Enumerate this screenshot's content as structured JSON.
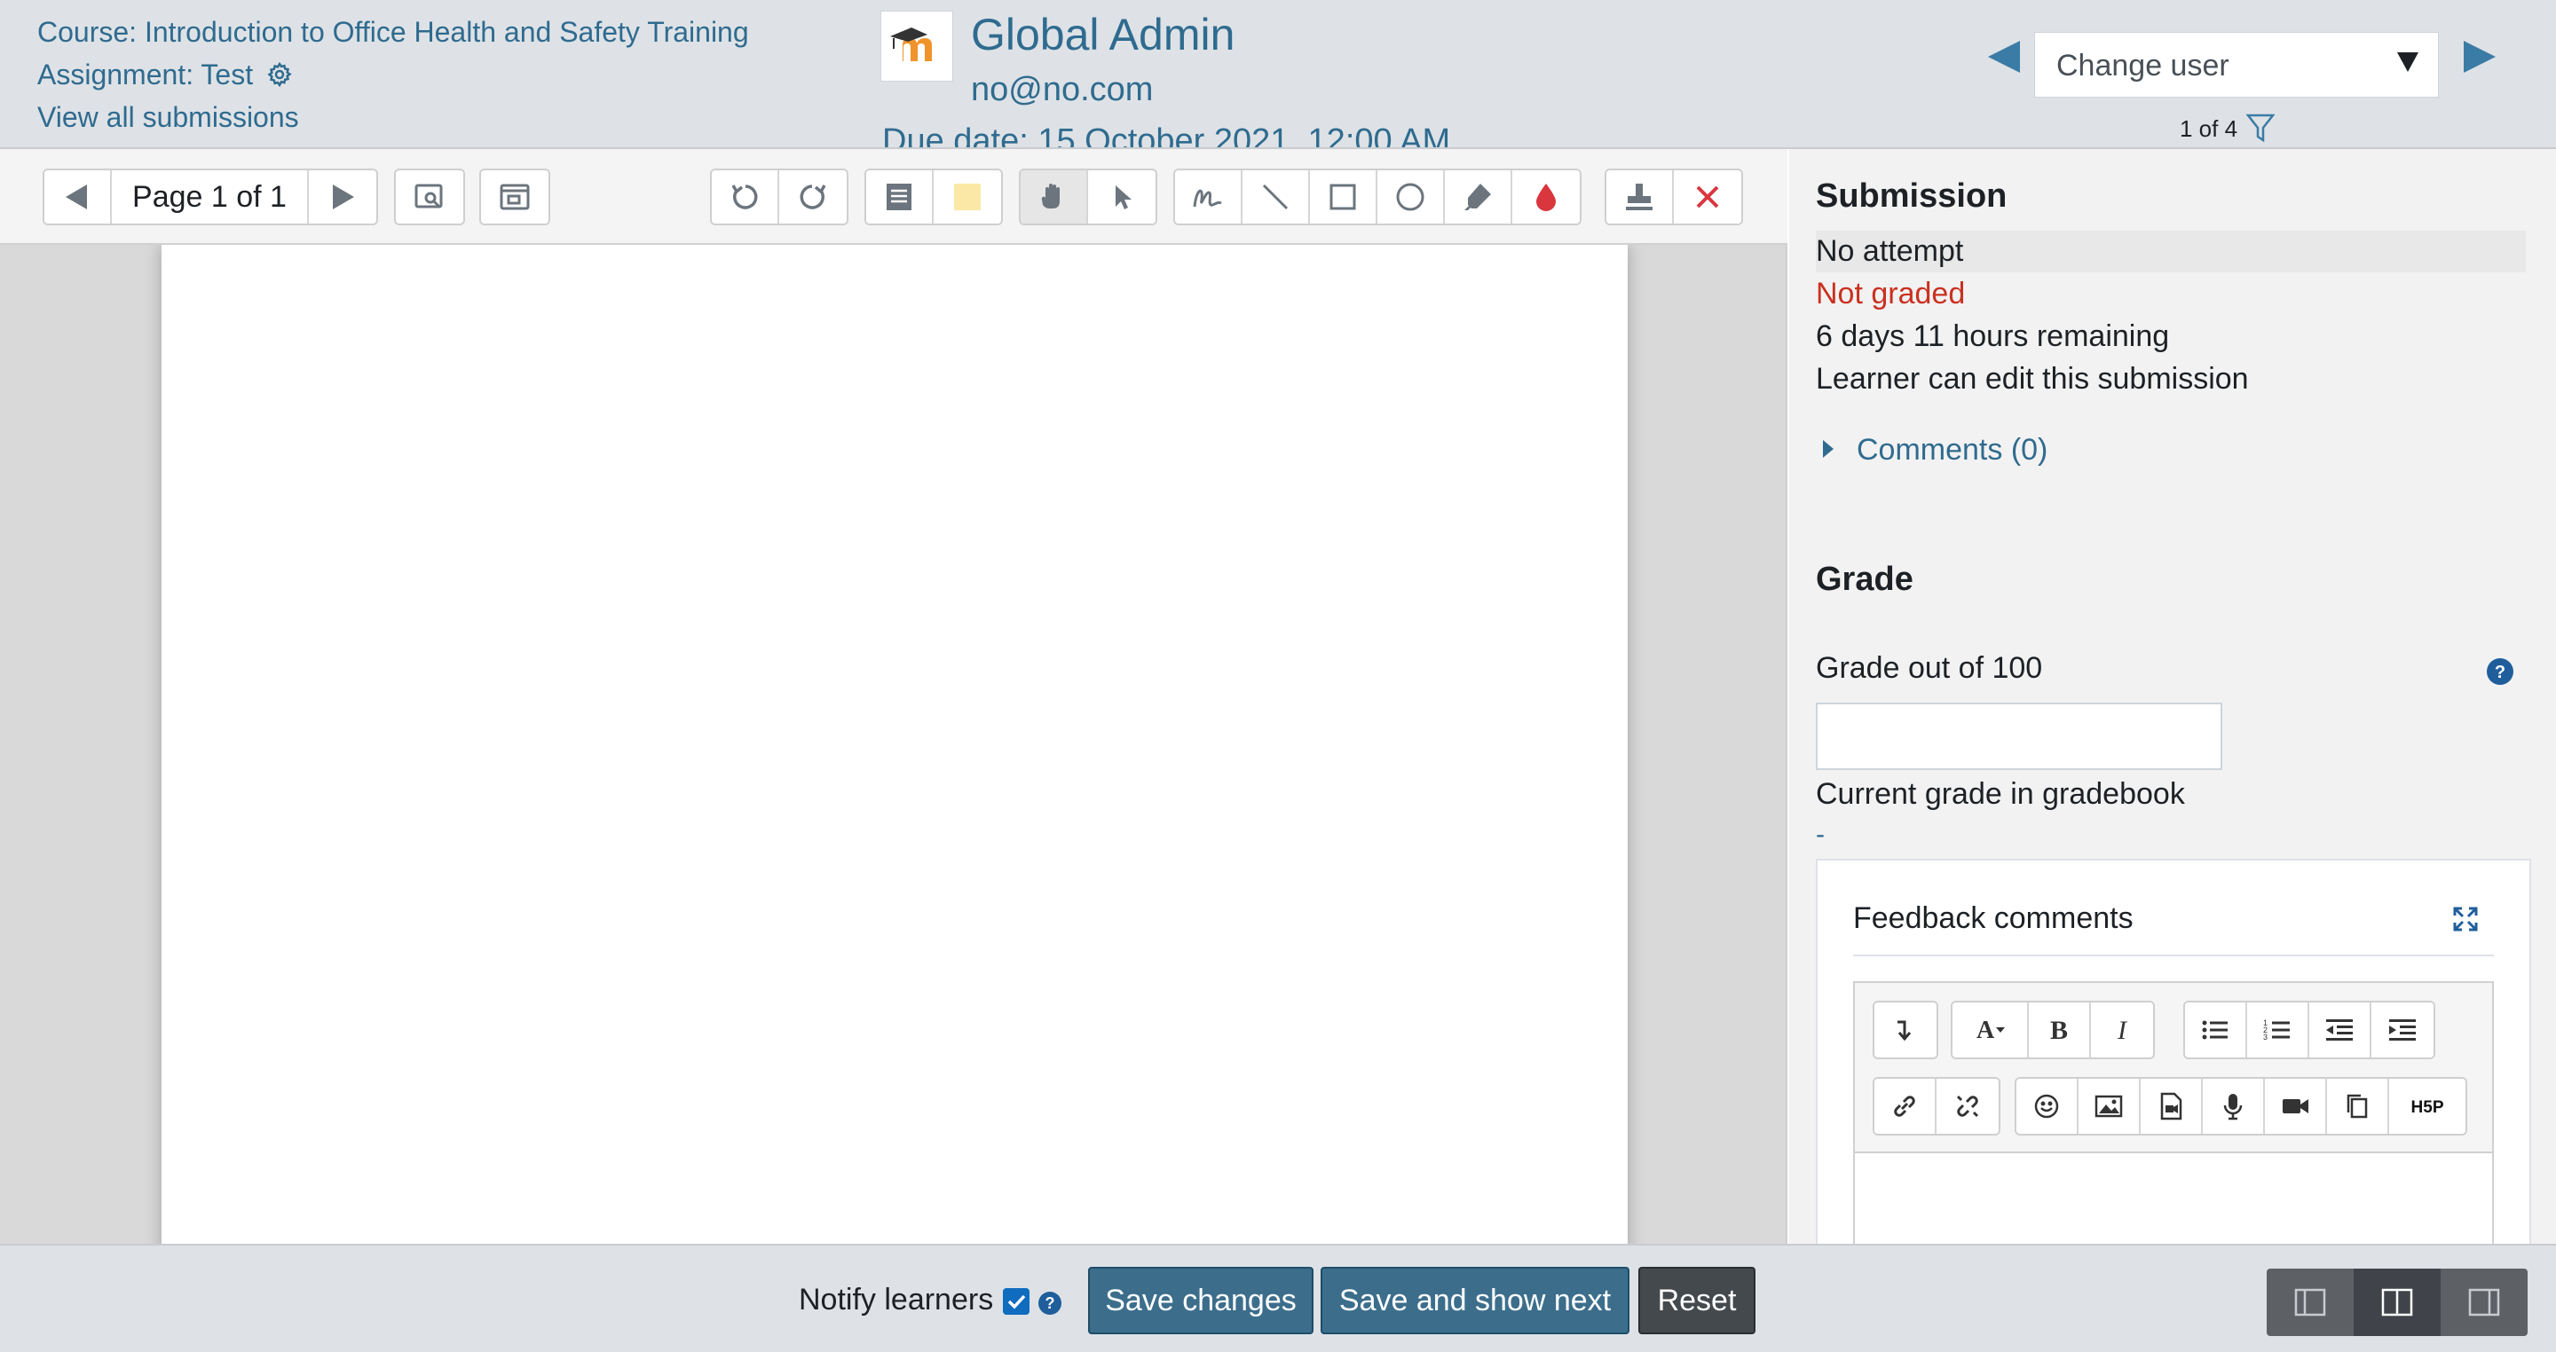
{
  "header": {
    "course_link": "Course: Introduction to Office Health and Safety Training",
    "assignment_link": "Assignment: Test",
    "view_all_link": "View all submissions",
    "user_name": "Global Admin",
    "user_email": "no@no.com",
    "due_date": "Due date: 15 October 2021, 12:00 AM",
    "change_user_placeholder": "Change user",
    "user_count": "1 of 4"
  },
  "toolbar": {
    "page_label": "Page 1 of 1",
    "icons": [
      "prev-page-icon",
      "next-page-icon",
      "search-comments-icon",
      "expand-comments-icon",
      "rotate-left-icon",
      "rotate-right-icon",
      "comment-icon",
      "highlight-color-icon",
      "pan-icon",
      "select-icon",
      "pen-icon",
      "line-icon",
      "rectangle-icon",
      "oval-icon",
      "highlight-icon",
      "color-icon",
      "stamp-icon",
      "delete-icon"
    ]
  },
  "panel": {
    "submission_heading": "Submission",
    "status_attempt": "No attempt",
    "status_graded": "Not graded",
    "status_remaining": "6 days 11 hours remaining",
    "status_edit": "Learner can edit this submission",
    "comments_toggle": "Comments (0)",
    "grade_heading": "Grade",
    "grade_label": "Grade out of 100",
    "grade_value": "",
    "current_grade_label": "Current grade in gradebook",
    "current_grade_value": "-",
    "feedback_title": "Feedback comments"
  },
  "footer": {
    "notify_label": "Notify learners",
    "notify_checked": true,
    "save_changes": "Save changes",
    "save_and_next": "Save and show next",
    "reset": "Reset"
  },
  "colors": {
    "link": "#2f6b8f",
    "not_graded": "#ca3120",
    "primary_button": "#3c6e8c",
    "secondary_button": "#44494e",
    "header_bg": "#dee2e6"
  }
}
